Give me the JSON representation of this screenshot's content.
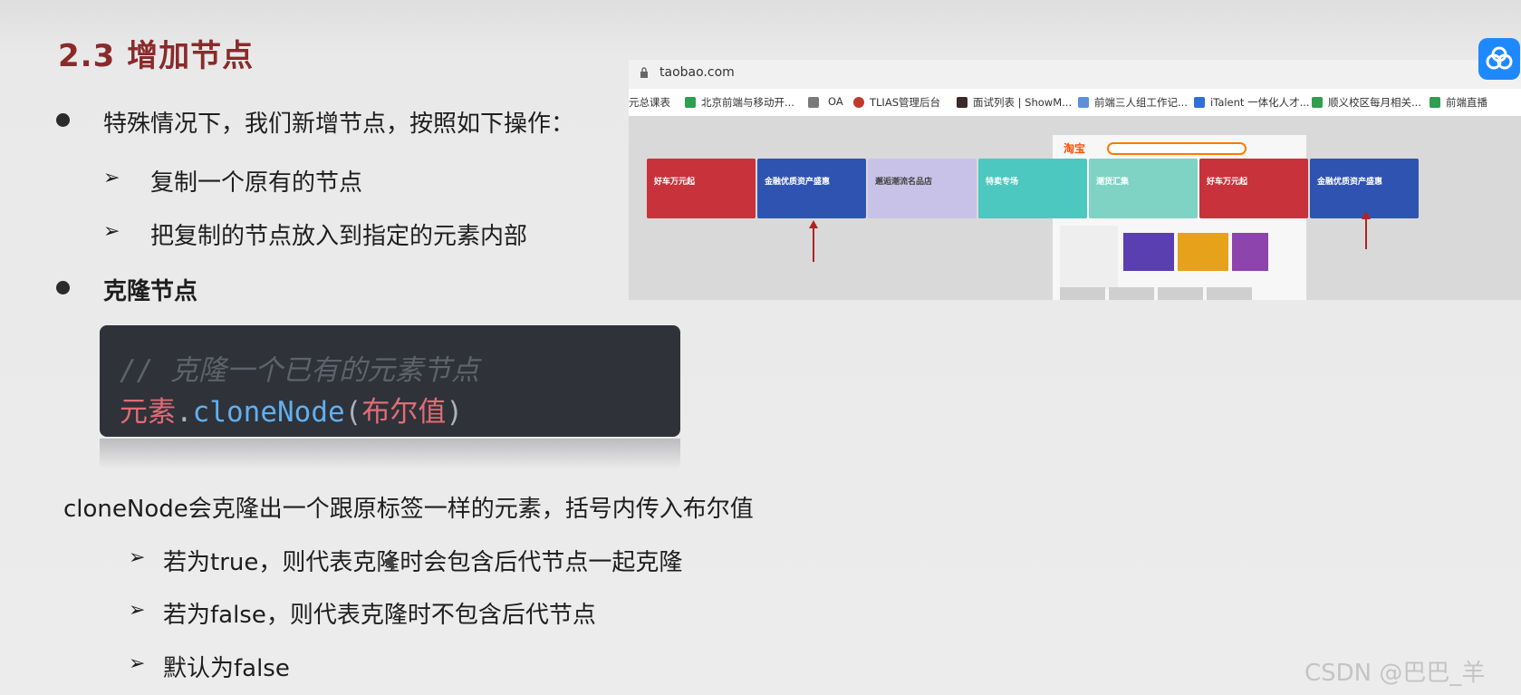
{
  "slide": {
    "title": "2.3 增加节点",
    "bullet1": "特殊情况下，我们新增节点，按照如下操作：",
    "bullet1_sub": [
      "复制一个原有的节点",
      "把复制的节点放入到指定的元素内部"
    ],
    "bullet2": "克隆节点",
    "code": {
      "comment": "// 克隆一个已有的元素节点",
      "obj": "元素",
      "dot": ".",
      "method": "cloneNode",
      "paren_open": "(",
      "arg": "布尔值",
      "paren_close": ")"
    },
    "desc": "cloneNode会克隆出一个跟原标签一样的元素，括号内传入布尔值",
    "desc_sub": [
      "若为true，则代表克隆时会包含后代节点一起克隆",
      "若为false，则代表克隆时不包含后代节点",
      "默认为false"
    ],
    "arrow_glyph": "➢"
  },
  "browser": {
    "url": "taobao.com",
    "bookmarks": [
      "元总课表",
      "北京前端与移动开...",
      "OA",
      "TLIAS管理后台",
      "面试列表 | ShowM...",
      "前端三人组工作记...",
      "iTalent 一体化人才...",
      "顺义校区每月相关...",
      "前端直播"
    ],
    "banners": [
      "好车万元起",
      "金融优质资产盛惠",
      "邂逅潮流名品店",
      "特卖专场",
      "潮货汇集",
      "好车万元起",
      "金融优质资产盛惠"
    ],
    "logo": "淘宝"
  },
  "watermark": "CSDN @巴巴_羊",
  "colors": {
    "title": "#8b2a2a",
    "code_bg": "#2f3238",
    "method": "#61afef",
    "keyword": "#e06c75",
    "accent_blue": "#1e88ff"
  }
}
